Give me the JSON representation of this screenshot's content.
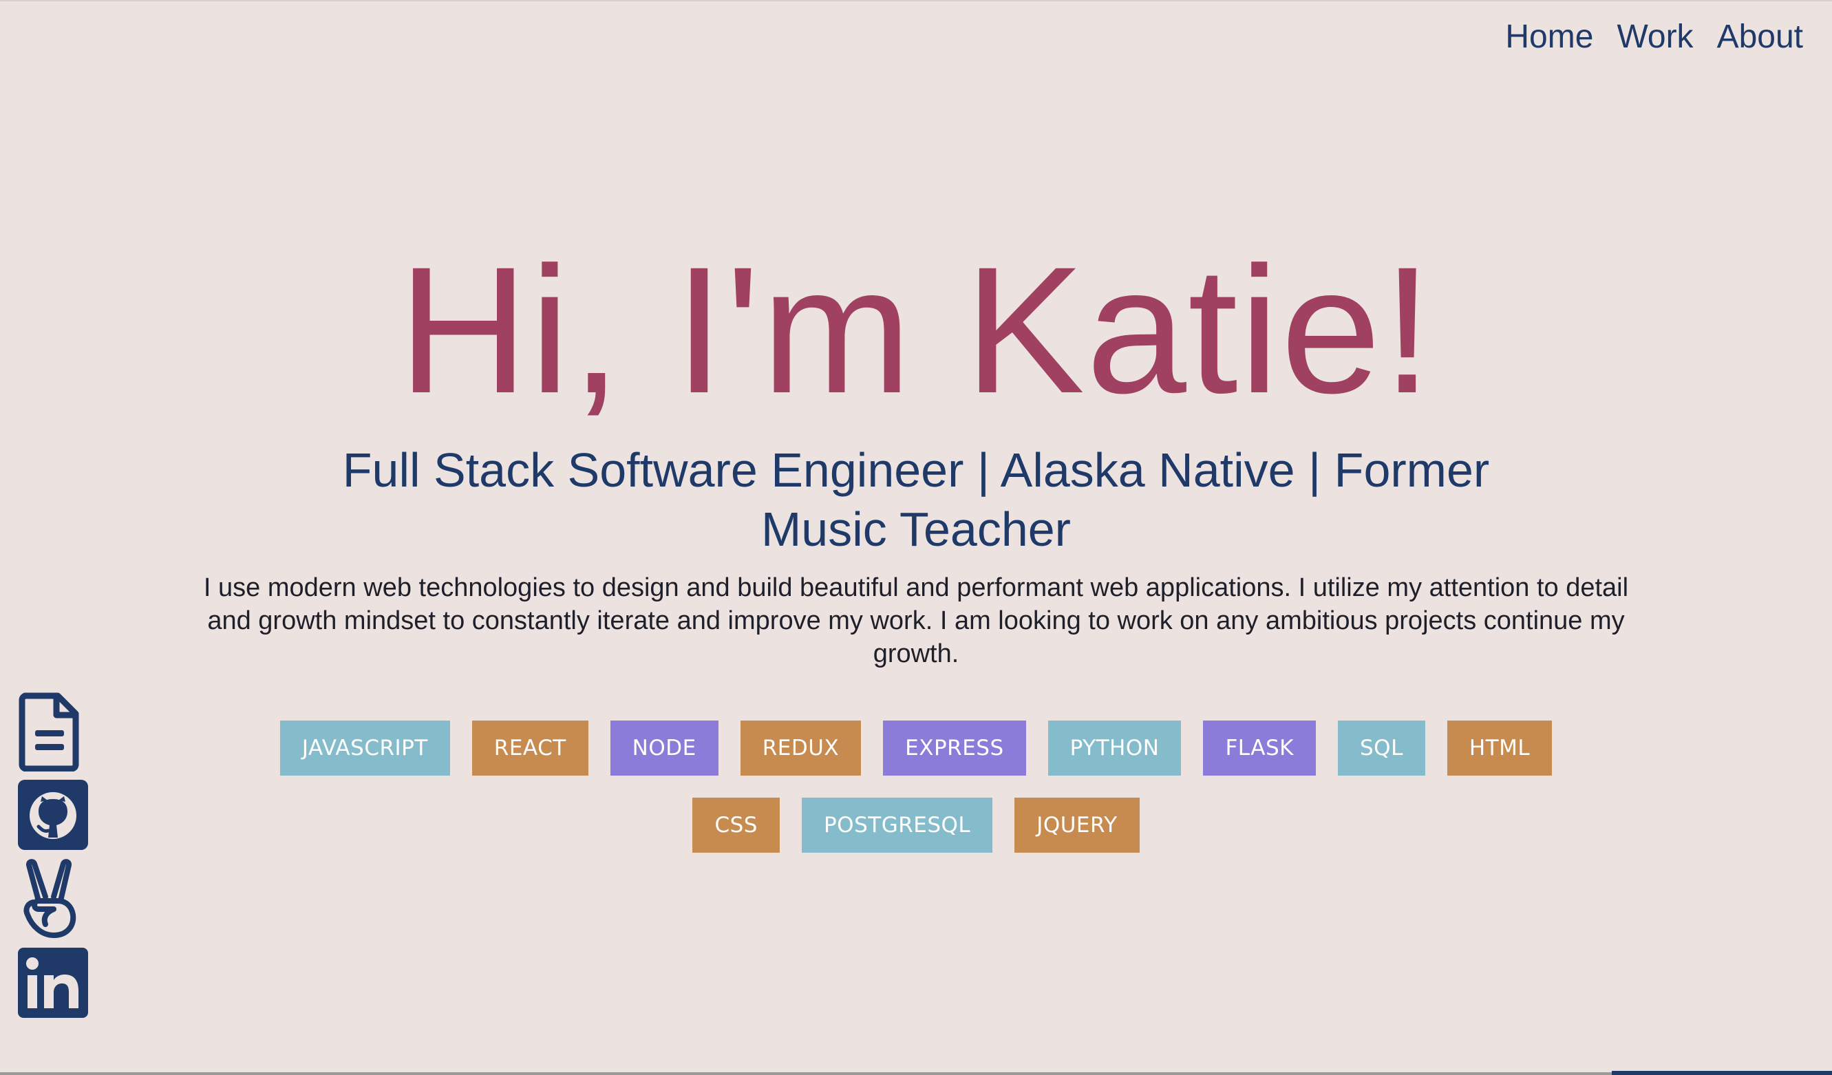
{
  "nav": {
    "items": [
      {
        "label": "Home"
      },
      {
        "label": "Work"
      },
      {
        "label": "About"
      }
    ]
  },
  "hero": {
    "title": "Hi, I'm Katie!",
    "subtitle": "Full Stack Software Engineer | Alaska Native | Former Music Teacher",
    "intro": "I use modern web technologies to design and build beautiful and performant web applications. I utilize my attention to detail and growth mindset to constantly iterate and improve my work. I am looking to work on any ambitious projects continue my growth."
  },
  "skills": [
    {
      "label": "JAVASCRIPT",
      "color": "#85bccb"
    },
    {
      "label": "REACT",
      "color": "#c78b4f"
    },
    {
      "label": "NODE",
      "color": "#8a7cd8"
    },
    {
      "label": "REDUX",
      "color": "#c78b4f"
    },
    {
      "label": "EXPRESS",
      "color": "#8a7cd8"
    },
    {
      "label": "PYTHON",
      "color": "#85bccb"
    },
    {
      "label": "FLASK",
      "color": "#8a7cd8"
    },
    {
      "label": "SQL",
      "color": "#85bccb"
    },
    {
      "label": "HTML",
      "color": "#c78b4f"
    },
    {
      "label": "CSS",
      "color": "#c78b4f"
    },
    {
      "label": "POSTGRESQL",
      "color": "#85bccb"
    },
    {
      "label": "JQUERY",
      "color": "#c78b4f"
    }
  ],
  "social": [
    {
      "icon": "resume-document-icon"
    },
    {
      "icon": "github-icon"
    },
    {
      "icon": "angellist-icon"
    },
    {
      "icon": "linkedin-icon"
    }
  ],
  "colors": {
    "background": "#ece3e0",
    "accent": "#a14161",
    "navy": "#1f3a68",
    "skill_blue": "#85bccb",
    "skill_orange": "#c78b4f",
    "skill_purple": "#8a7cd8"
  }
}
